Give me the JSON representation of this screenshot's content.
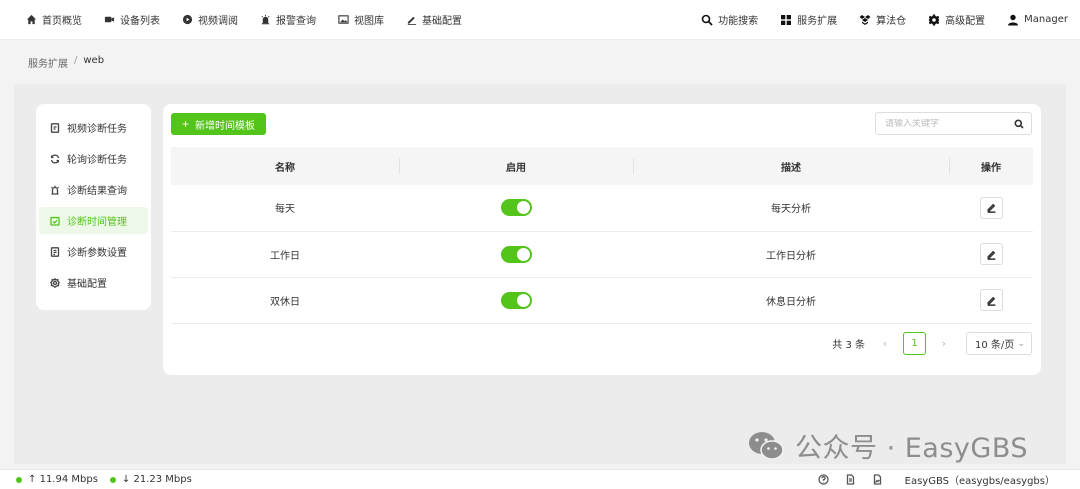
{
  "nav": {
    "left": [
      {
        "label": "首页概览",
        "icon": "home-icon"
      },
      {
        "label": "设备列表",
        "icon": "camera-icon"
      },
      {
        "label": "视频调阅",
        "icon": "play-icon"
      },
      {
        "label": "报警查询",
        "icon": "alarm-icon"
      },
      {
        "label": "视图库",
        "icon": "image-icon"
      },
      {
        "label": "基础配置",
        "icon": "pen-icon"
      }
    ],
    "right": [
      {
        "label": "功能搜索",
        "icon": "search-icon"
      },
      {
        "label": "服务扩展",
        "icon": "grid-icon"
      },
      {
        "label": "算法仓",
        "icon": "box-icon"
      },
      {
        "label": "高级配置",
        "icon": "gear-icon"
      },
      {
        "label": "Manager",
        "icon": "user-icon"
      }
    ]
  },
  "breadcrumb": {
    "parent": "服务扩展",
    "separator": "/",
    "current": "web"
  },
  "sidemenu": {
    "items": [
      {
        "label": "视频诊断任务",
        "icon": "task-icon",
        "active": false
      },
      {
        "label": "轮询诊断任务",
        "icon": "refresh-icon",
        "active": false
      },
      {
        "label": "诊断结果查询",
        "icon": "result-icon",
        "active": false
      },
      {
        "label": "诊断时间管理",
        "icon": "calendar-check-icon",
        "active": true
      },
      {
        "label": "诊断参数设置",
        "icon": "params-icon",
        "active": false
      },
      {
        "label": "基础配置",
        "icon": "settings-icon",
        "active": false
      }
    ]
  },
  "toolbar": {
    "add_label": "新增时间模板",
    "search_placeholder": "请输入关键字"
  },
  "table": {
    "headers": {
      "name": "名称",
      "enabled": "启用",
      "desc": "描述",
      "op": "操作"
    },
    "rows": [
      {
        "name": "每天",
        "enabled": true,
        "desc": "每天分析"
      },
      {
        "name": "工作日",
        "enabled": true,
        "desc": "工作日分析"
      },
      {
        "name": "双休日",
        "enabled": true,
        "desc": "休息日分析"
      }
    ]
  },
  "pagination": {
    "total": "共 3 条",
    "current_page": "1",
    "page_size": "10 条/页",
    "prev": "‹",
    "next": "›"
  },
  "watermark": {
    "text": "公众号 · EasyGBS"
  },
  "status": {
    "upload": "11.94 Mbps",
    "download": "21.23 Mbps",
    "up_arrow": "↑",
    "down_arrow": "↓",
    "version": "EasyGBS（easygbs/easygbs）"
  },
  "colors": {
    "accent": "#52c41a",
    "background": "#f3f3f3"
  }
}
